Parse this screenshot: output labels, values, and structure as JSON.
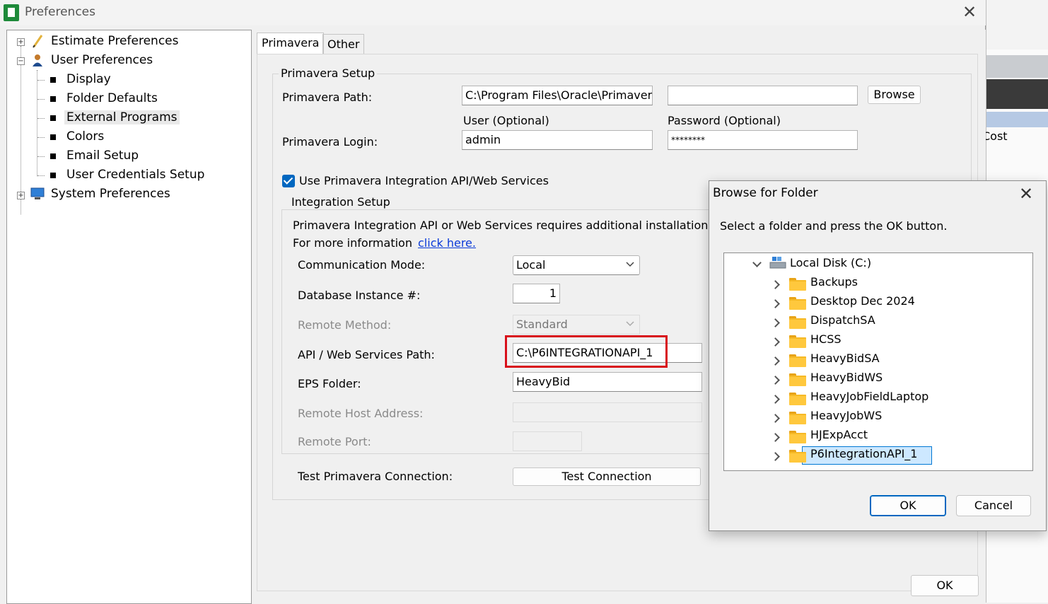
{
  "window": {
    "title": "Preferences",
    "ok_label": "OK"
  },
  "tree": {
    "items": [
      {
        "label": "Estimate Preferences"
      },
      {
        "label": "User Preferences"
      },
      {
        "label": "Display"
      },
      {
        "label": "Folder Defaults"
      },
      {
        "label": "External Programs"
      },
      {
        "label": "Colors"
      },
      {
        "label": "Email Setup"
      },
      {
        "label": "User Credentials Setup"
      },
      {
        "label": "System Preferences"
      }
    ]
  },
  "tabs": [
    {
      "label": "Primavera"
    },
    {
      "label": "Other"
    }
  ],
  "primavera_setup": {
    "group_title": "Primavera Setup",
    "path_label": "Primavera Path:",
    "path_value": "C:\\Program Files\\Oracle\\Primavera F",
    "path_extra_value": "",
    "browse_label": "Browse",
    "user_label": "User (Optional)",
    "password_label": "Password (Optional)",
    "login_label": "Primavera Login:",
    "user_value": "admin",
    "password_value": "********"
  },
  "integration": {
    "checkbox_label": "Use Primavera Integration API/Web Services",
    "group_title": "Integration Setup",
    "info_text": "Primavera Integration API or Web Services requires additional installation files and c",
    "more_info_label": "For more information",
    "link_label": "click here.",
    "comm_mode_label": "Communication Mode:",
    "comm_mode_value": "Local",
    "db_instance_label": "Database Instance #:",
    "db_instance_value": "1",
    "remote_method_label": "Remote Method:",
    "remote_method_value": "Standard",
    "api_path_label": "API / Web Services Path:",
    "api_path_value": "C:\\P6INTEGRATIONAPI_1",
    "eps_folder_label": "EPS Folder:",
    "eps_folder_value": "HeavyBid",
    "remote_host_label": "Remote Host Address:",
    "remote_host_value": "",
    "remote_port_label": "Remote Port:",
    "remote_port_value": "",
    "test_label": "Test Primavera Connection:",
    "test_button_label": "Test Connection"
  },
  "browse_dialog": {
    "title": "Browse for Folder",
    "instruction": "Select a folder and press the OK button.",
    "root": "Local Disk (C:)",
    "folders": [
      {
        "name": "Backups"
      },
      {
        "name": "Desktop Dec 2024"
      },
      {
        "name": "DispatchSA"
      },
      {
        "name": "HCSS"
      },
      {
        "name": "HeavyBidSA"
      },
      {
        "name": "HeavyBidWS"
      },
      {
        "name": "HeavyJobFieldLaptop"
      },
      {
        "name": "HeavyJobWS"
      },
      {
        "name": "HJExpAcct"
      },
      {
        "name": "P6IntegrationAPI_1"
      }
    ],
    "selected": "P6IntegrationAPI_1",
    "ok_label": "OK",
    "cancel_label": "Cancel"
  },
  "background_app": {
    "partial_text": "Cost"
  },
  "colors": {
    "accent": "#0067c0",
    "highlight_border": "#d8101a",
    "link": "#0b3bd8",
    "folder": "#ffc83d"
  }
}
